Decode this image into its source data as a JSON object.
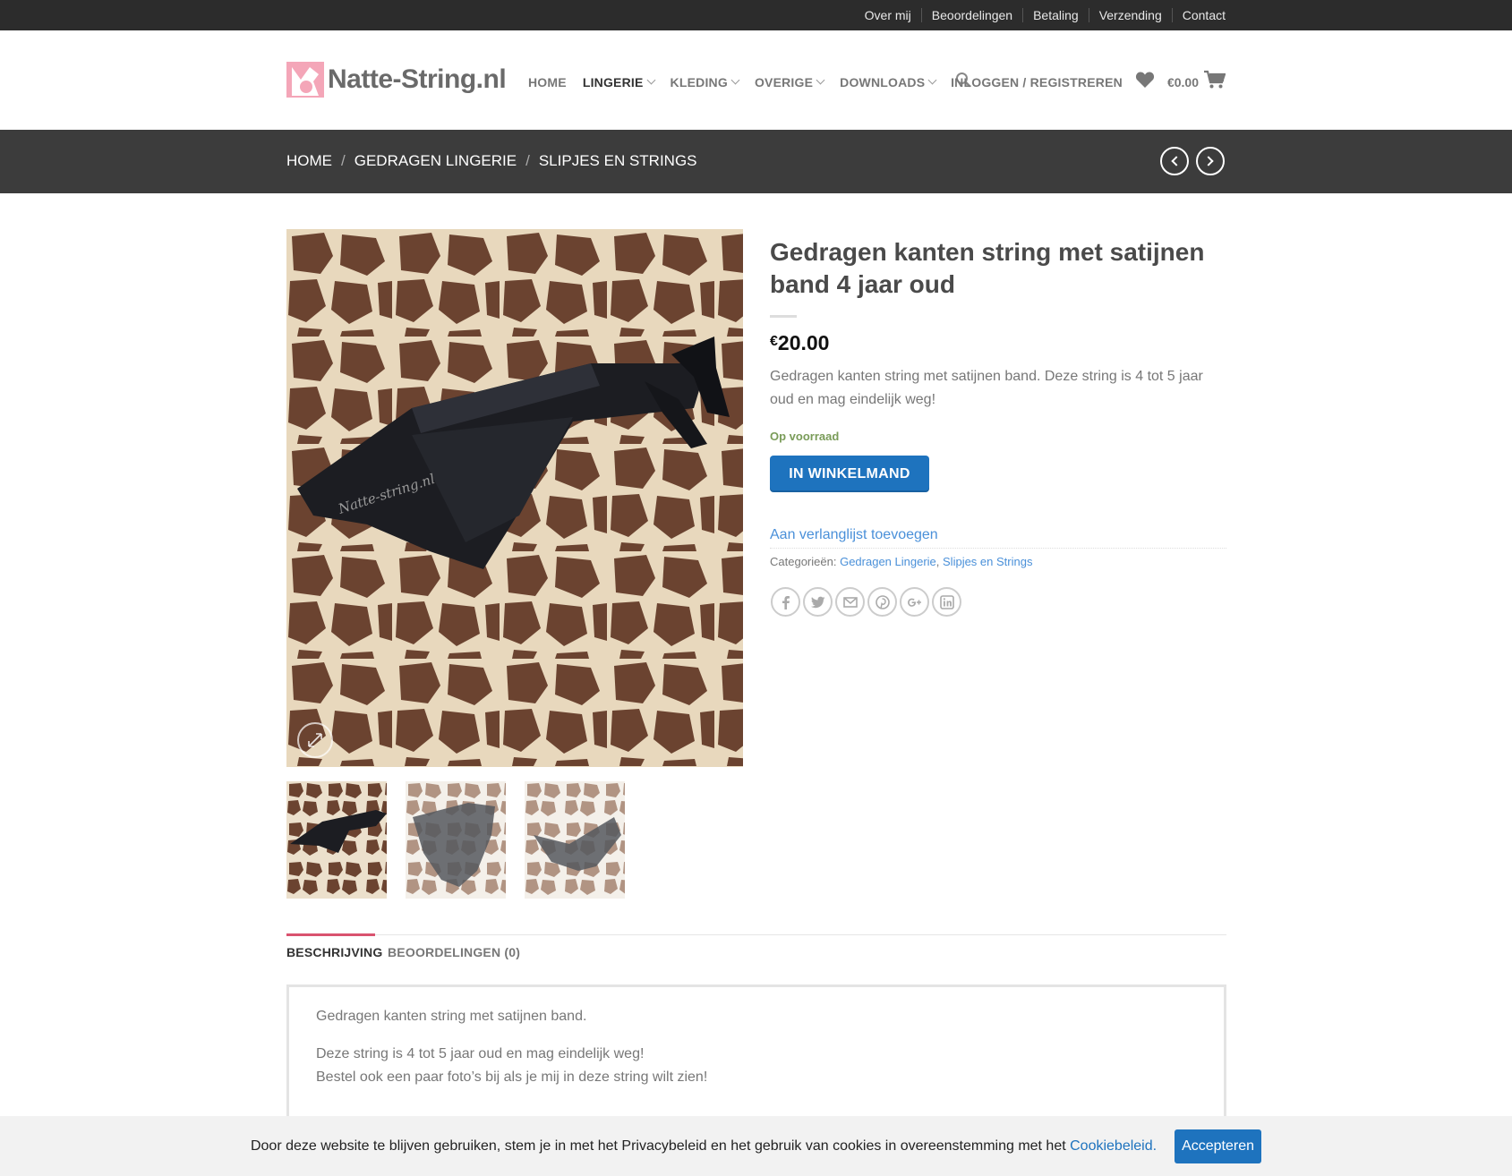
{
  "topbar": {
    "links": [
      "Over mij",
      "Beoordelingen",
      "Betaling",
      "Verzending",
      "Contact"
    ]
  },
  "header": {
    "logo_text": "Natte-String.nl",
    "nav": [
      {
        "label": "HOME",
        "dropdown": false,
        "active": false
      },
      {
        "label": "LINGERIE",
        "dropdown": true,
        "active": true
      },
      {
        "label": "KLEDING",
        "dropdown": true,
        "active": false
      },
      {
        "label": "OVERIGE",
        "dropdown": true,
        "active": false
      },
      {
        "label": "DOWNLOADS",
        "dropdown": true,
        "active": false
      }
    ],
    "login_label": "INLOGGEN / REGISTREREN",
    "cart_total": "€0.00"
  },
  "breadcrumb": {
    "items": [
      "HOME",
      "GEDRAGEN LINGERIE",
      "SLIPJES EN STRINGS"
    ]
  },
  "product": {
    "title": "Gedragen kanten string met satijnen band 4 jaar oud",
    "price_currency": "€",
    "price_amount": "20.00",
    "short_description": "Gedragen kanten string met satijnen band. Deze string is 4 tot 5 jaar oud en mag eindelijk weg!",
    "stock": "Op voorraad",
    "add_to_cart_label": "IN WINKELMAND",
    "wishlist_label": "Aan verlanglijst toevoegen",
    "categories_label": "Categorieën:",
    "categories": [
      "Gedragen Lingerie",
      "Slipjes en Strings"
    ],
    "share_icons": [
      "facebook-icon",
      "twitter-icon",
      "email-icon",
      "pinterest-icon",
      "google-plus-icon",
      "linkedin-icon"
    ],
    "image_watermark": "Natte-string.nl"
  },
  "tabs": [
    {
      "label": "BESCHRIJVING",
      "active": true
    },
    {
      "label": "BEOORDELINGEN (0)",
      "active": false
    }
  ],
  "description": {
    "p1": "Gedragen kanten string met satijnen band.",
    "p2_line1": "Deze string is 4 tot 5 jaar oud en mag eindelijk weg!",
    "p2_line2": "Bestel ook een paar foto’s bij als je mij in deze string wilt zien!"
  },
  "cookie": {
    "text": "Door deze website te blijven gebruiken, stem je in met het Privacybeleid en het gebruik van cookies in overeenstemming met het",
    "link": "Cookiebeleid.",
    "button": "Accepteren"
  },
  "colors": {
    "topbar_bg": "#2c2c2c",
    "breadcrumb_bg": "#3c3c3c",
    "primary_button": "#1e73be",
    "link": "#4a90d9",
    "in_stock": "#7a9c59",
    "tab_accent": "#d9536f",
    "logo_pink": "#f4a6b8"
  }
}
